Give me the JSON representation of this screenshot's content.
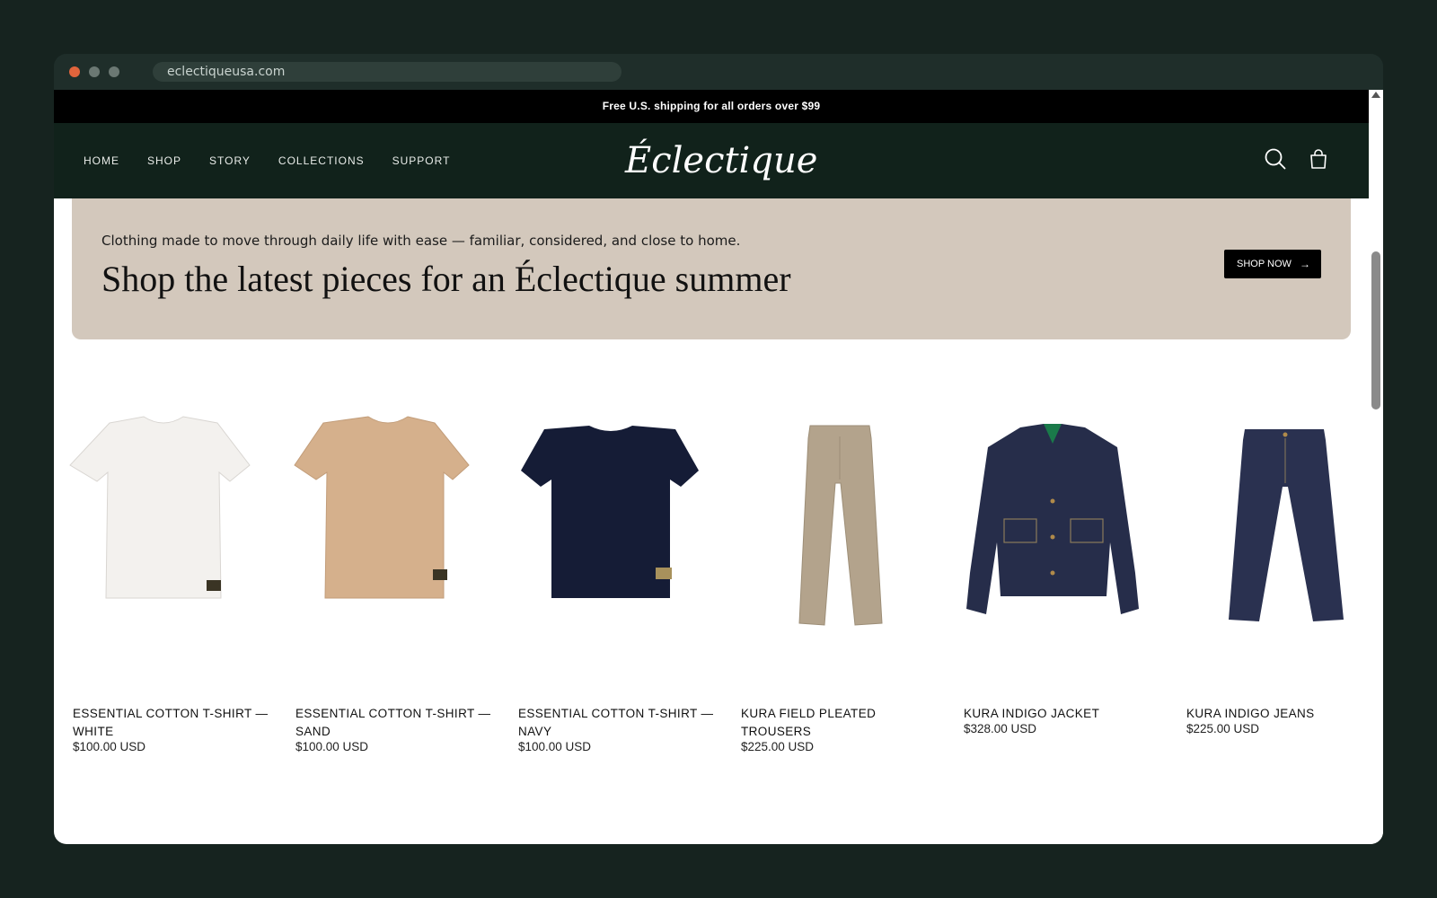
{
  "browser": {
    "url": "eclectiqueusa.com"
  },
  "promo_bar": {
    "text": "Free U.S. shipping for all orders over $99"
  },
  "header": {
    "nav": [
      "HOME",
      "SHOP",
      "STORY",
      "COLLECTIONS",
      "SUPPORT"
    ],
    "logo_text": "Éclectique",
    "icons": [
      "search-icon",
      "shopping-bag-icon"
    ]
  },
  "hero": {
    "subtitle": "Clothing made to move through daily life with ease — familiar, considered, and close to home.",
    "title": "Shop the latest pieces for an Éclectique summer",
    "button_label": "SHOP NOW"
  },
  "products": [
    {
      "title": "ESSENTIAL COTTON T-SHIRT — WHITE",
      "price": "$100.00 USD",
      "color": "#f3f1ee"
    },
    {
      "title": "ESSENTIAL COTTON T-SHIRT — SAND",
      "price": "$100.00 USD",
      "color": "#d5b08c"
    },
    {
      "title": "ESSENTIAL COTTON T-SHIRT — NAVY",
      "price": "$100.00 USD",
      "color": "#151c36"
    },
    {
      "title": "KURA FIELD PLEATED TROUSERS",
      "price": "$225.00 USD",
      "color": "#b3a38c"
    },
    {
      "title": "KURA INDIGO JACKET",
      "price": "$328.00 USD",
      "color": "#262d4a"
    },
    {
      "title": "KURA INDIGO JEANS",
      "price": "$225.00 USD",
      "color": "#2a3150"
    }
  ],
  "colors": {
    "header_bg": "#11221b",
    "hero_bg": "#d3c8bc",
    "promo_bg": "#000000"
  }
}
